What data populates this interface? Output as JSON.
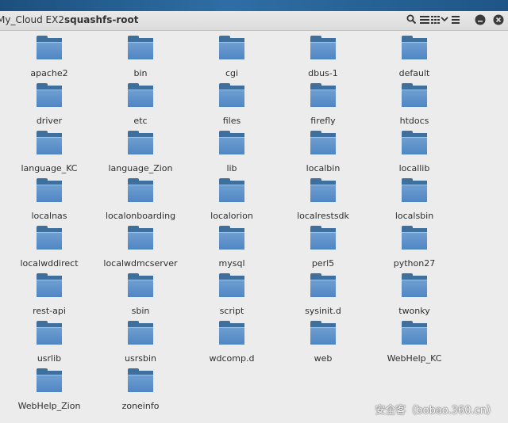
{
  "window": {
    "path_prefix": "My_Cloud EX2",
    "path_current": "squashfs-root"
  },
  "folders": [
    "apache2",
    "bin",
    "cgi",
    "dbus-1",
    "default",
    "driver",
    "etc",
    "files",
    "firefly",
    "htdocs",
    "language_KC",
    "language_Zion",
    "lib",
    "localbin",
    "locallib",
    "localnas",
    "localonboarding",
    "localorion",
    "localrestsdk",
    "localsbin",
    "localwddirect",
    "localwdmcserver",
    "mysql",
    "perl5",
    "python27",
    "rest-api",
    "sbin",
    "script",
    "sysinit.d",
    "twonky",
    "usrlib",
    "usrsbin",
    "wdcomp.d",
    "web",
    "WebHelp_KC",
    "WebHelp_Zion",
    "zoneinfo"
  ],
  "watermark": "安全客（bobao.360.cn）",
  "colors": {
    "folder": "#5a8fc9",
    "folder_tab": "#3f6f9d",
    "background": "#ececec"
  }
}
